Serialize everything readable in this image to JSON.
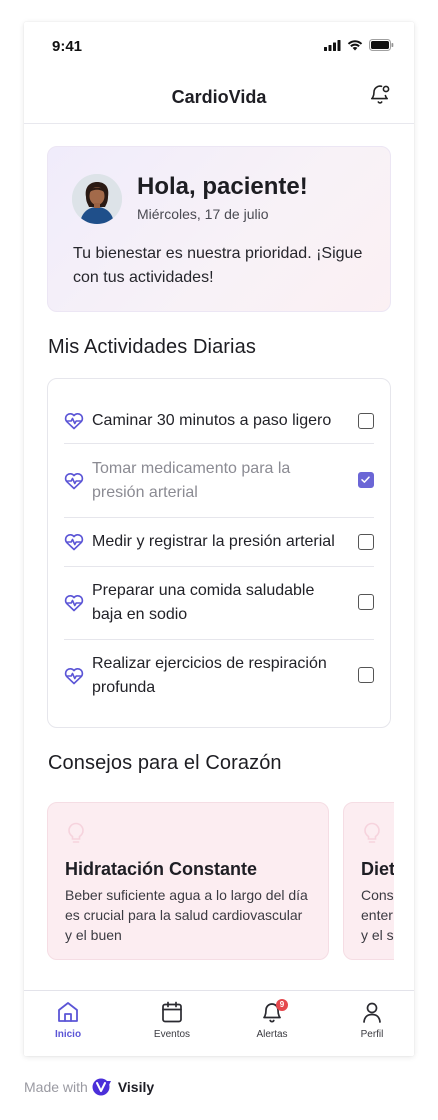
{
  "status_bar": {
    "time": "9:41"
  },
  "header": {
    "title": "CardioVida"
  },
  "greeting": {
    "title": "Hola, paciente!",
    "date": "Miércoles, 17 de julio",
    "message": "Tu bienestar es nuestra prioridad. ¡Sigue con tus actividades!"
  },
  "activities": {
    "title": "Mis Actividades Diarias",
    "items": [
      {
        "label": "Caminar 30 minutos a paso ligero",
        "checked": false
      },
      {
        "label": "Tomar medicamento para la presión arterial",
        "checked": true
      },
      {
        "label": "Medir y registrar la presión arterial",
        "checked": false
      },
      {
        "label": "Preparar una comida saludable baja en sodio",
        "checked": false
      },
      {
        "label": "Realizar ejercicios de respiración profunda",
        "checked": false
      }
    ]
  },
  "tips": {
    "title": "Consejos para el Corazón",
    "items": [
      {
        "title": "Hidratación Constante",
        "text": "Beber suficiente agua a lo largo del día es crucial para la salud cardiovascular y el buen"
      },
      {
        "title": "Dieta",
        "text": "Cons\nenter\ny el s"
      }
    ]
  },
  "tab_bar": {
    "tabs": [
      {
        "label": "Inicio",
        "icon": "home-icon",
        "active": true
      },
      {
        "label": "Eventos",
        "icon": "calendar-icon",
        "active": false
      },
      {
        "label": "Alertas",
        "icon": "bell-icon",
        "active": false,
        "badge": "9"
      },
      {
        "label": "Perfil",
        "icon": "user-icon",
        "active": false
      }
    ]
  },
  "footer": {
    "made_with": "Made with",
    "brand": "Visily"
  },
  "colors": {
    "accent": "#5b55d6",
    "check": "#6b66d6",
    "tip_bg": "#fcedf1",
    "badge": "#e5484d"
  }
}
